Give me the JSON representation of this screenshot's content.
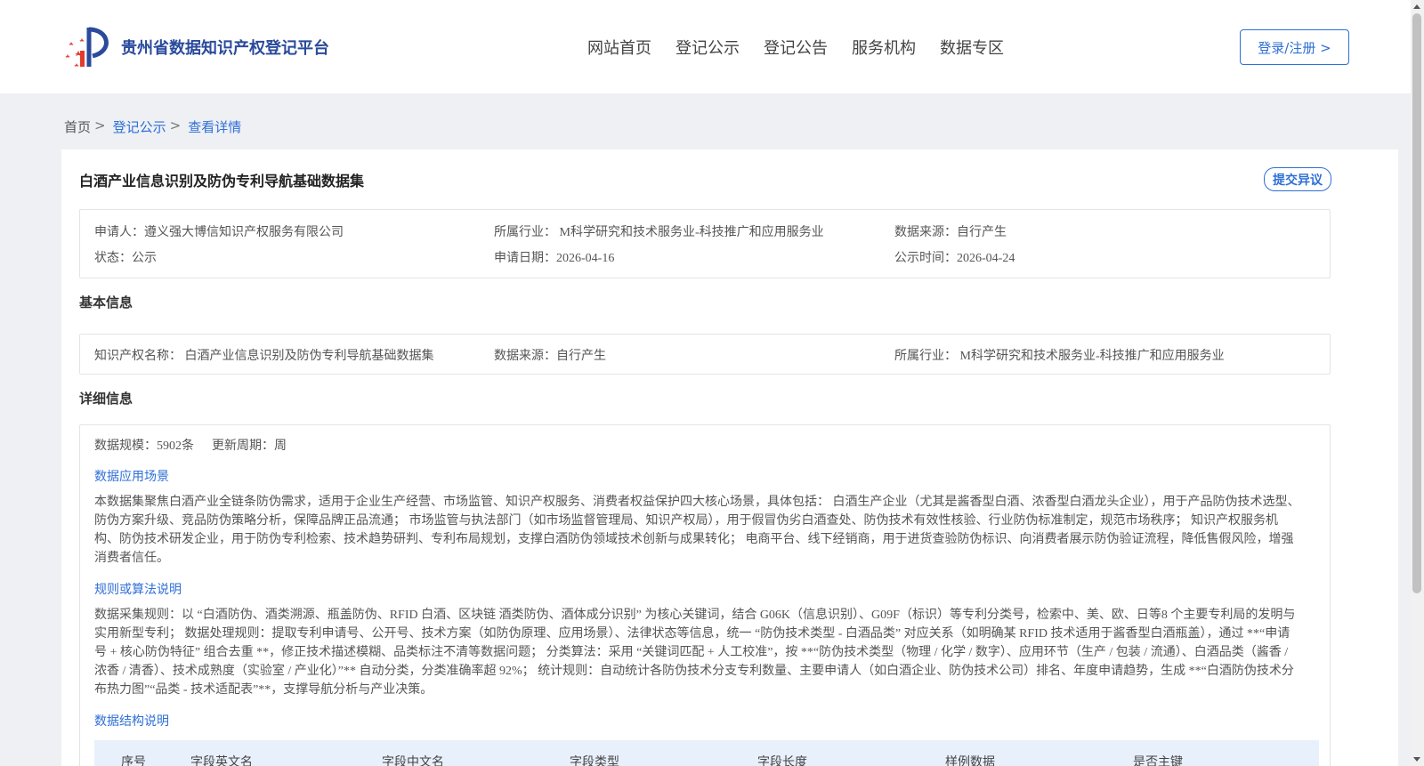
{
  "header": {
    "logo_text": "贵州省数据知识产权登记平台",
    "nav": [
      "网站首页",
      "登记公示",
      "登记公告",
      "服务机构",
      "数据专区"
    ],
    "login_label": "登录/注册 >"
  },
  "breadcrumb": {
    "home": "首页",
    "sep": ">",
    "items": [
      "登记公示",
      "查看详情"
    ]
  },
  "detail": {
    "title": "白酒产业信息识别及防伪专利导航基础数据集",
    "objection_label": "提交异议",
    "summary": {
      "applicant": "申请人：遵义强大博信知识产权服务有限公司",
      "industry": "所属行业： M科学研究和技术服务业-科技推广和应用服务业",
      "source": "数据来源：自行产生",
      "status": "状态：公示",
      "apply_date": "申请日期：2026-04-16",
      "publish_time": "公示时间：2026-04-24"
    },
    "basic_title": "基本信息",
    "basic": {
      "ip_name": "知识产权名称： 白酒产业信息识别及防伪专利导航基础数据集",
      "source": "数据来源：自行产生",
      "industry": "所属行业： M科学研究和技术服务业-科技推广和应用服务业"
    },
    "detail_title": "详细信息",
    "scale": "数据规模：5902条",
    "update_cycle": "更新周期：周",
    "scenario_title": "数据应用场景",
    "scenario_text": "本数据集聚焦白酒产业全链条防伪需求，适用于企业生产经营、市场监管、知识产权服务、消费者权益保护四大核心场景，具体包括： 白酒生产企业（尤其是酱香型白酒、浓香型白酒龙头企业），用于产品防伪技术选型、防伪方案升级、竞品防伪策略分析，保障品牌正品流通； 市场监管与执法部门（如市场监督管理局、知识产权局），用于假冒伪劣白酒查处、防伪技术有效性核验、行业防伪标准制定，规范市场秩序； 知识产权服务机构、防伪技术研发企业，用于防伪专利检索、技术趋势研判、专利布局规划，支撑白酒防伪领域技术创新与成果转化； 电商平台、线下经销商，用于进货查验防伪标识、向消费者展示防伪验证流程，降低售假风险，增强消费者信任。",
    "rules_title": "规则或算法说明",
    "rules_text": "数据采集规则：以 “白酒防伪、酒类溯源、瓶盖防伪、RFID 白酒、区块链 酒类防伪、酒体成分识别” 为核心关键词，结合 G06K（信息识别）、G09F（标识）等专利分类号，检索中、美、欧、日等8 个主要专利局的发明与实用新型专利； 数据处理规则：提取专利申请号、公开号、技术方案（如防伪原理、应用场景）、法律状态等信息，统一 “防伪技术类型 - 白酒品类” 对应关系（如明确某 RFID 技术适用于酱香型白酒瓶盖），通过 **“申请号 + 核心防伪特征” 组合去重 **，修正技术描述模糊、品类标注不清等数据问题； 分类算法：采用 “关键词匹配 + 人工校准”，按 **“防伪技术类型（物理 / 化学 / 数字）、应用环节（生产 / 包装 / 流通）、白酒品类（酱香 / 浓香 / 清香）、技术成熟度（实验室 / 产业化）”** 自动分类，分类准确率超 92%； 统计规则：自动统计各防伪技术分支专利数量、主要申请人（如白酒企业、防伪技术公司）排名、年度申请趋势，生成 **“白酒防伪技术分布热力图”“品类 - 技术适配表”**，支撑导航分析与产业决策。",
    "structure_title": "数据结构说明",
    "table_headers": [
      "序号",
      "字段英文名",
      "字段中文名",
      "字段类型",
      "字段长度",
      "样例数据",
      "是否主键"
    ]
  }
}
